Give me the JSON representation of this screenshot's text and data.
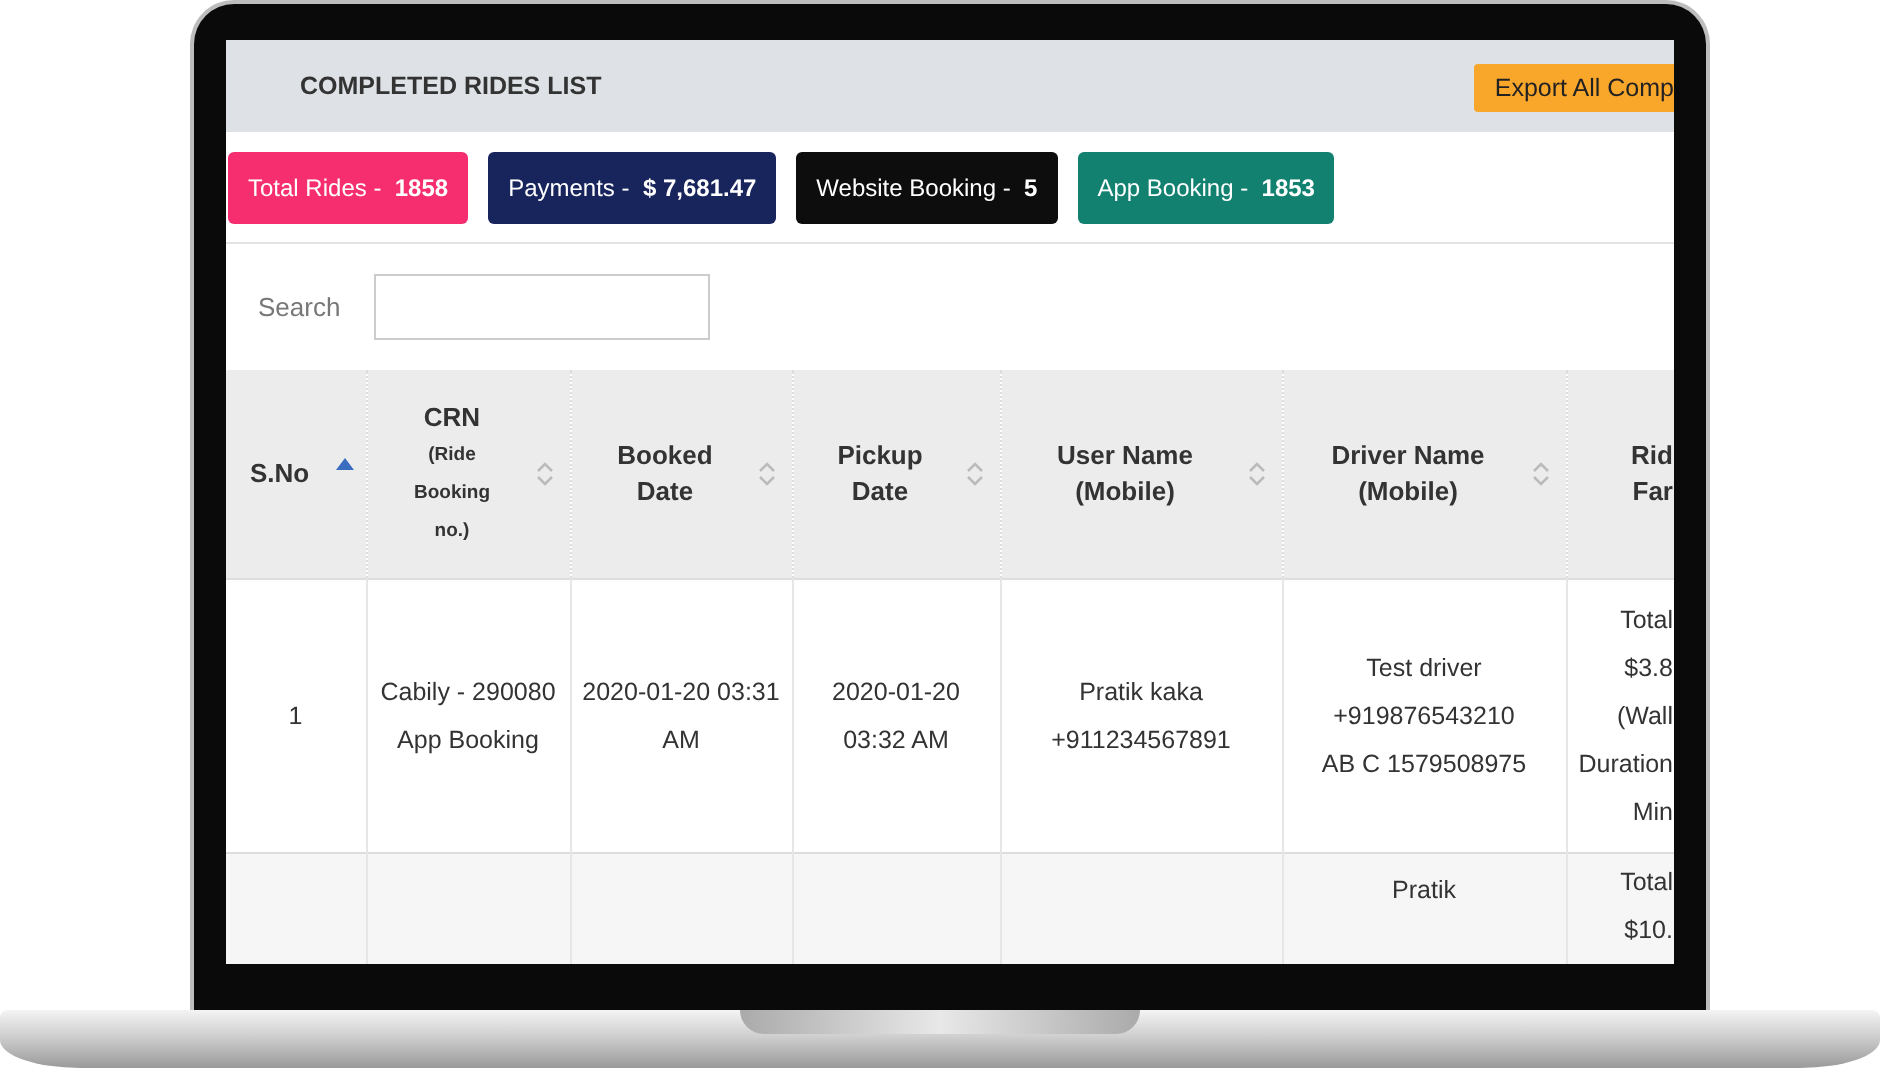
{
  "header": {
    "title": "COMPLETED RIDES LIST",
    "export_button": "Export All Comp"
  },
  "stats": [
    {
      "label": "Total Rides - ",
      "value": "1858",
      "color": "#f62d6e"
    },
    {
      "label": "Payments - ",
      "value": "$ 7,681.47",
      "color": "#18255c"
    },
    {
      "label": "Website Booking - ",
      "value": "5",
      "color": "#0d0d0d"
    },
    {
      "label": "App Booking - ",
      "value": "1853",
      "color": "#128170"
    }
  ],
  "search": {
    "label": "Search"
  },
  "table": {
    "columns": [
      {
        "lines": [
          "S.No"
        ],
        "sorted": true
      },
      {
        "lines": [
          "CRN",
          "(Ride",
          "Booking",
          "no.)"
        ],
        "sorted": false
      },
      {
        "lines": [
          "Booked",
          "Date"
        ],
        "sorted": false
      },
      {
        "lines": [
          "Pickup",
          "Date"
        ],
        "sorted": false
      },
      {
        "lines": [
          "User Name",
          "(Mobile)"
        ],
        "sorted": false
      },
      {
        "lines": [
          "Driver Name",
          "(Mobile)"
        ],
        "sorted": false
      },
      {
        "lines": [
          "Rid",
          "Far"
        ]
      }
    ],
    "rows": [
      {
        "cells": [
          [
            "1"
          ],
          [
            "Cabily - 290080",
            "App Booking"
          ],
          [
            "2020-01-20 03:31",
            "AM"
          ],
          [
            "2020-01-20",
            "03:32 AM"
          ],
          [
            "Pratik kaka",
            "+911234567891"
          ],
          [
            "Test driver",
            "+919876543210",
            "AB C 1579508975"
          ],
          [
            "Total",
            "$3.8",
            "(Wall",
            "Duration",
            "Min"
          ]
        ]
      },
      {
        "cells": [
          [],
          [],
          [],
          [],
          [],
          [
            "Pratik"
          ],
          [
            "Total",
            "$10."
          ]
        ]
      }
    ]
  }
}
